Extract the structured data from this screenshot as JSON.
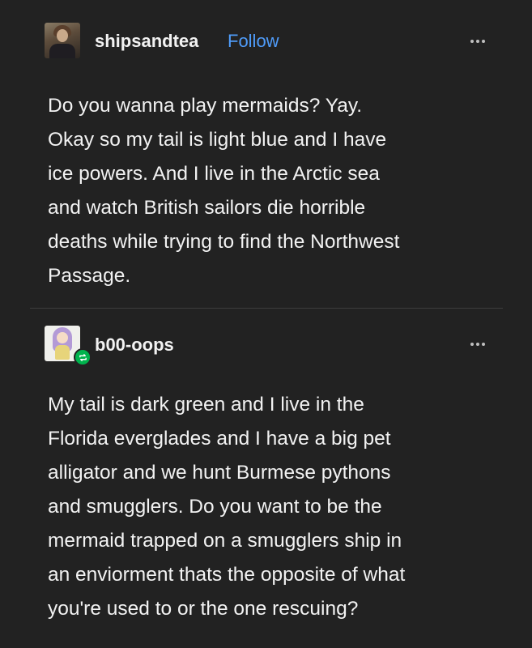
{
  "posts": [
    {
      "username": "shipsandtea",
      "follow_label": "Follow",
      "more_icon": "more-options-icon",
      "body": "Do you wanna play mermaids? Yay.\nOkay so my tail is light blue and I have\nice powers. And I live in the Arctic sea\nand watch British sailors die horrible\ndeaths while trying to find the Northwest\nPassage."
    },
    {
      "username": "b00-oops",
      "badge_icon": "reblog-icon",
      "more_icon": "more-options-icon",
      "body": "My tail is dark green and I live in the\nFlorida everglades and I have a big pet\nalligator and we hunt Burmese pythons\nand smugglers. Do you want to be the\nmermaid trapped on a smugglers ship in\nan enviorment thats the opposite of what\nyou're used to or the one rescuing?"
    }
  ],
  "colors": {
    "background": "#222222",
    "text": "#f2f2f2",
    "follow_link": "#4f9cfa",
    "reblog_badge": "#00b34d",
    "divider": "#3d3d3d"
  }
}
